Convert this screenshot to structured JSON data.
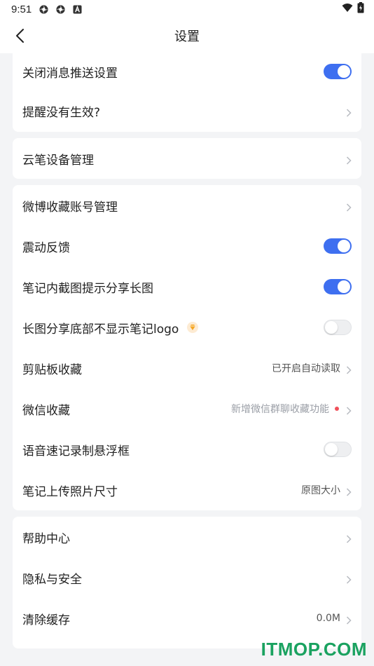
{
  "statusbar": {
    "time": "9:51",
    "icons": [
      "settings-gear-icon",
      "settings-gear-icon",
      "a-box-icon"
    ],
    "right_icons": [
      "wifi-icon",
      "battery-icon"
    ]
  },
  "header": {
    "title": "设置"
  },
  "colors": {
    "accent": "#3e6ff0",
    "background": "#f3f4f6",
    "red_dot": "#f0505a",
    "watermark": "#1aa260"
  },
  "groups": [
    {
      "items": [
        {
          "label": "关闭消息推送设置",
          "control": "toggle",
          "on": true
        },
        {
          "label": "提醒没有生效?",
          "control": "chevron"
        }
      ]
    },
    {
      "items": [
        {
          "label": "云笔设备管理",
          "control": "chevron"
        }
      ]
    },
    {
      "items": [
        {
          "label": "微博收藏账号管理",
          "control": "chevron"
        },
        {
          "label": "震动反馈",
          "control": "toggle",
          "on": true
        },
        {
          "label": "笔记内截图提示分享长图",
          "control": "toggle",
          "on": true
        },
        {
          "label": "长图分享底部不显示笔记logo",
          "control": "toggle",
          "on": false,
          "badge": "vip-diamond-icon"
        },
        {
          "label": "剪贴板收藏",
          "control": "chevron",
          "value": "已开启自动读取"
        },
        {
          "label": "微信收藏",
          "control": "chevron",
          "value": "新增微信群聊收藏功能",
          "dot": true
        },
        {
          "label": "语音速记录制悬浮框",
          "control": "toggle",
          "on": false
        },
        {
          "label": "笔记上传照片尺寸",
          "control": "chevron",
          "value": "原图大小"
        }
      ]
    },
    {
      "items": [
        {
          "label": "帮助中心",
          "control": "chevron"
        },
        {
          "label": "隐私与安全",
          "control": "chevron"
        },
        {
          "label": "清除缓存",
          "control": "chevron",
          "value": "0.0M"
        }
      ]
    }
  ],
  "watermark": "ITMOP.COM"
}
